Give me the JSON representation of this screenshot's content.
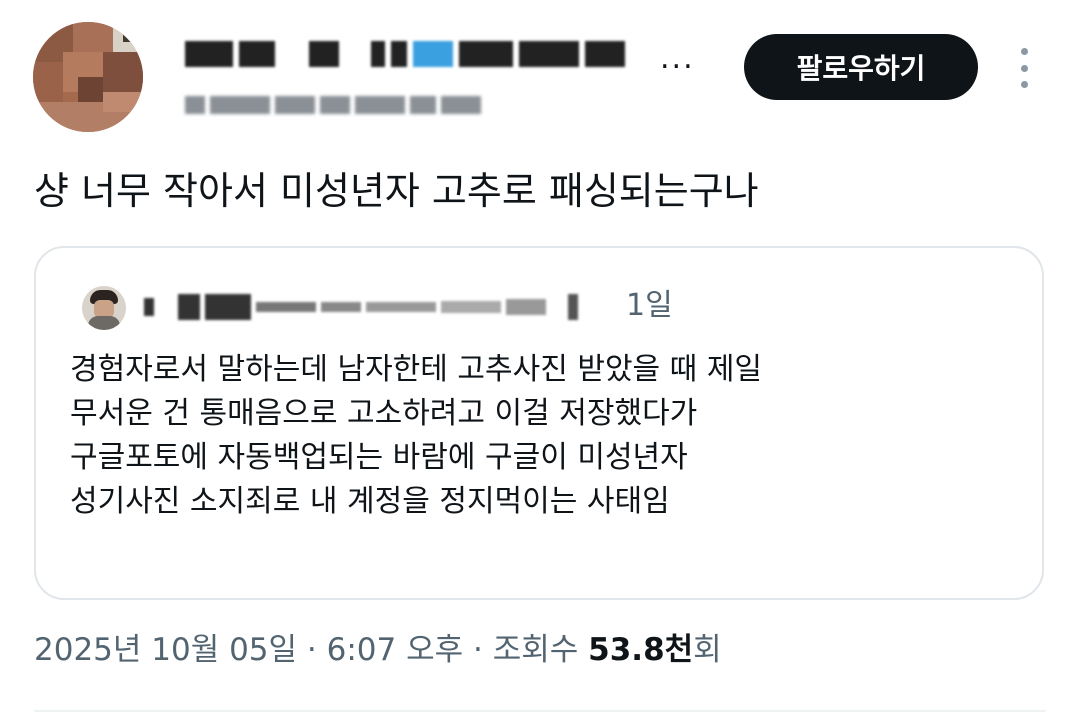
{
  "header": {
    "display_name": "",
    "follow_label": "팔로우하기",
    "more_icon": "more-vertical-icon",
    "truncation": "..."
  },
  "tweet": {
    "text": "샹 너무 작아서 미성년자 고추로 패싱되는구나"
  },
  "quote": {
    "date": "1일",
    "lines": [
      "경험자로서 말하는데 남자한테 고추사진 받았을 때 제일",
      "무서운 건 통매음으로 고소하려고 이걸 저장했다가",
      "구글포토에 자동백업되는 바람에 구글이 미성년자",
      "성기사진 소지죄로 내 계정을 정지먹이는 사태임"
    ]
  },
  "meta": {
    "date": "2025년 10월 05일",
    "separator": "·",
    "time": "6:07 오후",
    "views_label": "조회수",
    "views_count": "53.8천",
    "views_suffix": "회"
  },
  "colors": {
    "follow_bg": "#0f1419",
    "secondary_text": "#536471",
    "border": "#e1e6ea"
  }
}
